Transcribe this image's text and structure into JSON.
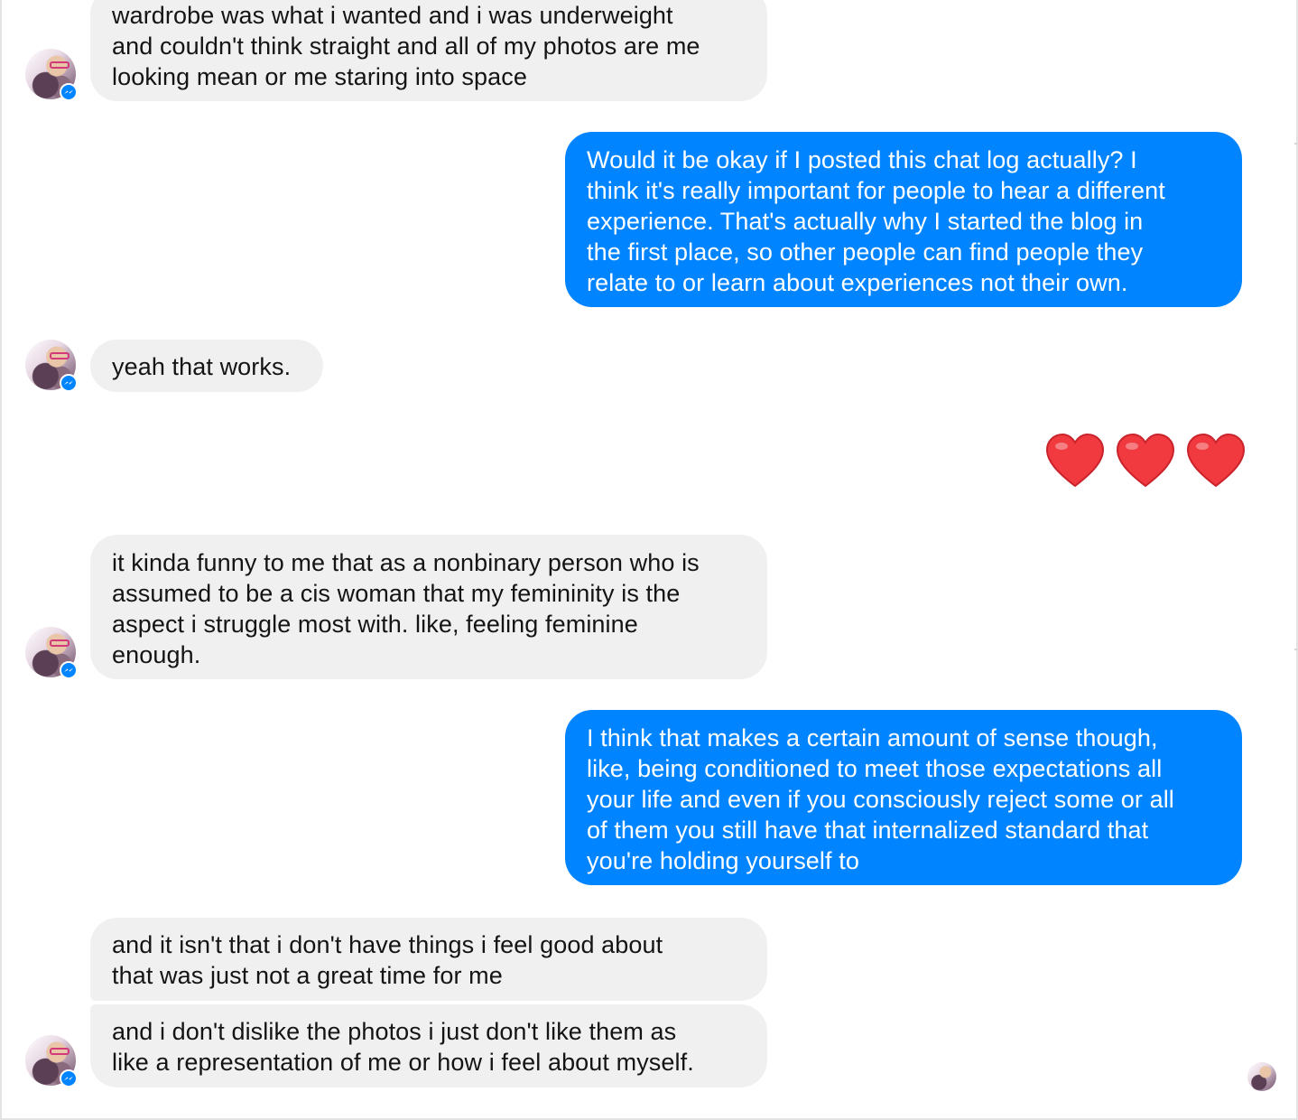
{
  "messages": [
    {
      "from": "them",
      "lines": [
        "wardrobe was what i wanted and i was underweight",
        "and couldn't think straight and all of my photos are me",
        "looking mean or me staring into space"
      ]
    },
    {
      "from": "me",
      "lines": [
        "Would it be okay if I posted this chat log actually? I",
        "think it's really important for people to hear a different",
        "experience. That's actually why I started the blog in",
        "the first place, so other people can find people they",
        "relate to or learn about experiences not their own."
      ]
    },
    {
      "from": "them",
      "lines": [
        "yeah that works."
      ]
    },
    {
      "from": "me",
      "emoji": "❤️❤️❤️"
    },
    {
      "from": "them",
      "lines": [
        "it kinda funny to me that as a nonbinary person who is",
        "assumed to be a cis woman that my femininity is the",
        "aspect i struggle most with. like, feeling feminine",
        "enough."
      ]
    },
    {
      "from": "me",
      "lines": [
        "I think that makes a certain amount of sense though,",
        "like, being conditioned to meet those expectations all",
        "your life and even if you consciously reject some or all",
        "of them you still have that internalized standard that",
        "you're holding yourself to"
      ]
    },
    {
      "from": "them",
      "lines": [
        "and it isn't that i don't have things i feel good about",
        "that was just not a great time for me"
      ]
    },
    {
      "from": "them",
      "lines": [
        "and i don't dislike the photos i just don't like them as",
        "like a representation of me or how i feel about myself."
      ]
    }
  ],
  "icons": {
    "avatar": "profile-avatar",
    "badge": "messenger-badge-icon",
    "heart": "red-heart-emoji",
    "receipt": "seen-avatar"
  },
  "colors": {
    "incoming_bubble": "#f0f0f0",
    "outgoing_bubble": "#0084ff",
    "heart": "#f03a3f"
  }
}
